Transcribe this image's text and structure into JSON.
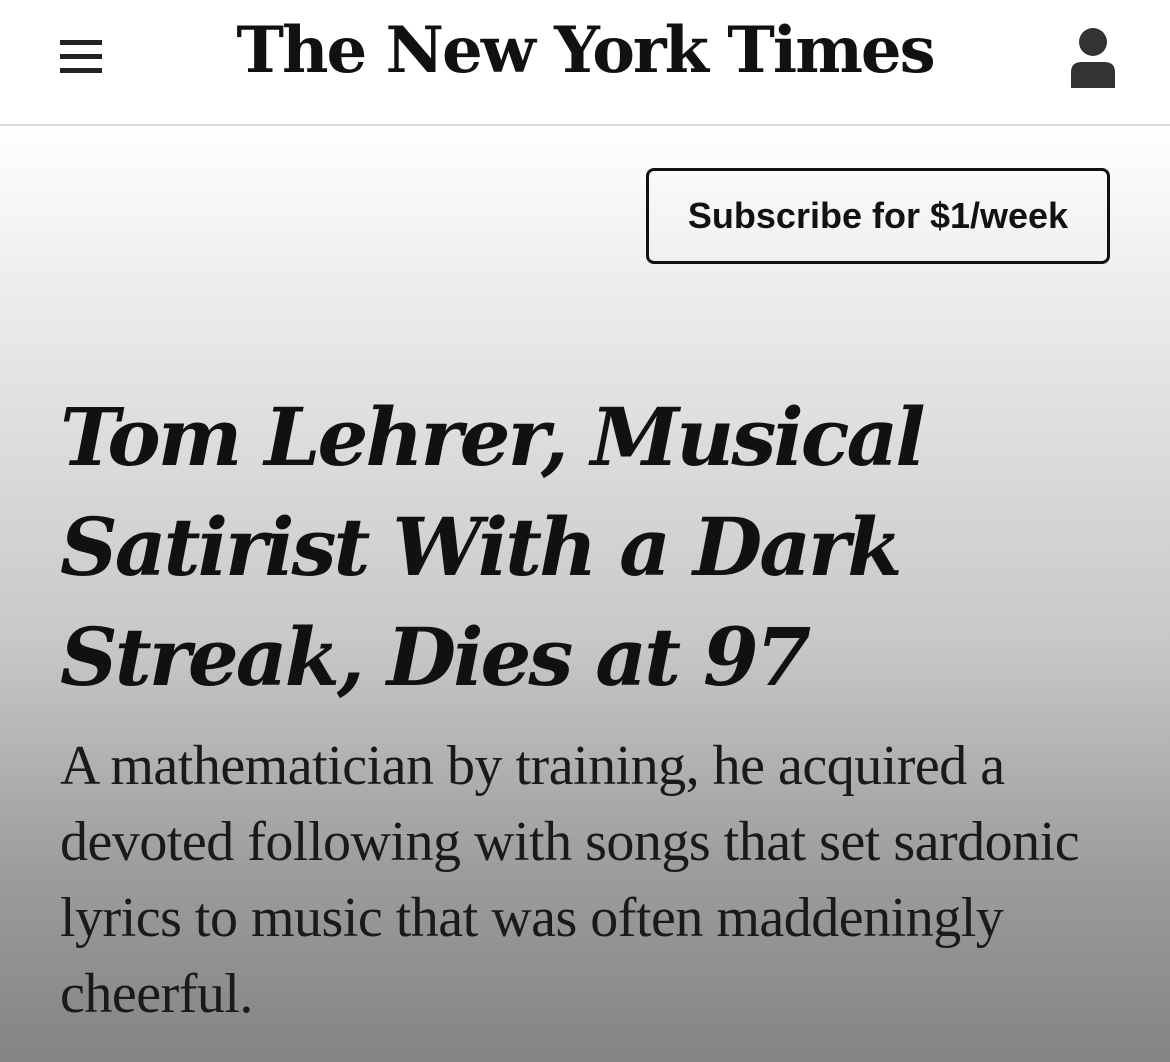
{
  "header": {
    "logo_text": "The New York Times",
    "menu_icon": "hamburger-menu-icon",
    "account_icon": "user-account-icon"
  },
  "subscribe": {
    "label": "Subscribe for $1/week"
  },
  "article": {
    "headline": "Tom Lehrer, Musical Satirist With a Dark Streak, Dies at 97",
    "summary": "A mathematician by training, he acquired a devoted following with songs that set sardonic lyrics to music that was often maddeningly cheerful."
  },
  "colors": {
    "text": "#121212",
    "header_background": "#ffffff",
    "gradient_top": "#ffffff",
    "gradient_bottom": "#848484"
  }
}
